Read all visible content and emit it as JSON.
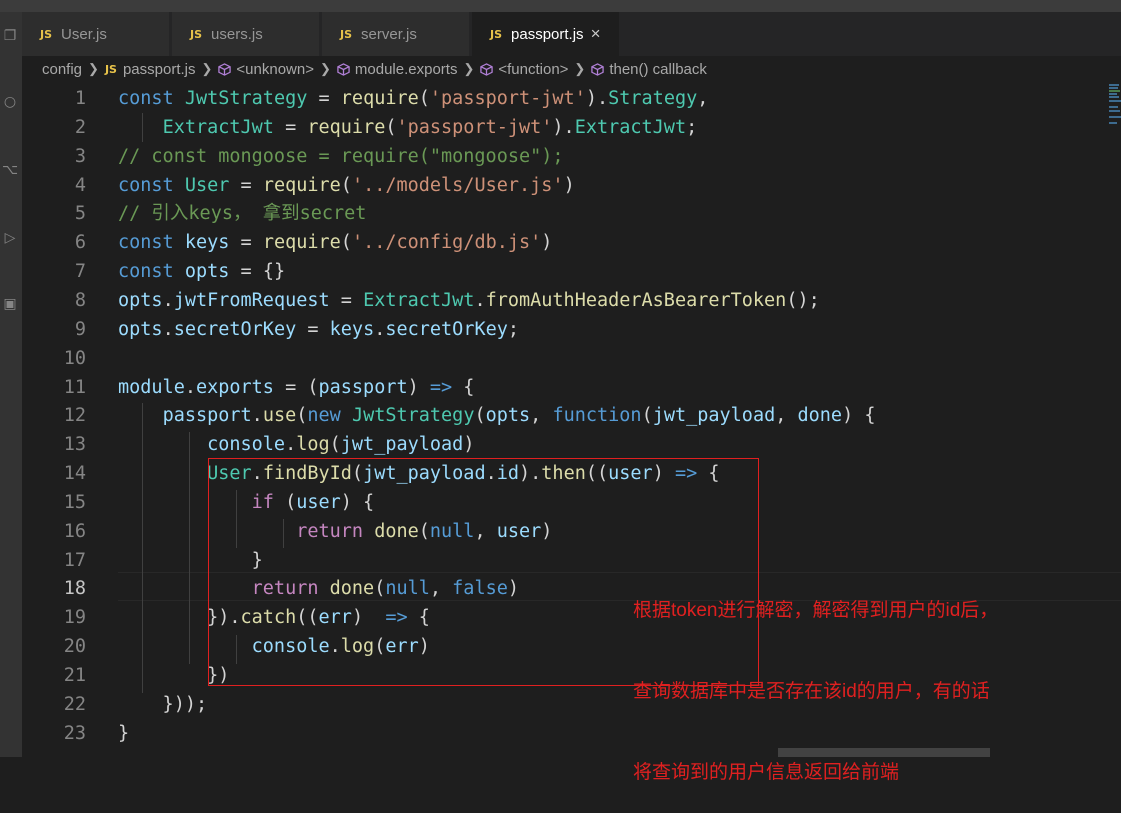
{
  "tabs": [
    {
      "badge": "JS",
      "name": "User.js"
    },
    {
      "badge": "JS",
      "name": "users.js"
    },
    {
      "badge": "JS",
      "name": "server.js"
    },
    {
      "badge": "JS",
      "name": "passport.js",
      "active": true,
      "close": "×"
    }
  ],
  "breadcrumb": {
    "folder": "config",
    "file_badge": "JS",
    "file": "passport.js",
    "items": [
      "<unknown>",
      "module.exports",
      "<function>",
      "then() callback"
    ]
  },
  "editor": {
    "current_line": 18,
    "line_numbers": [
      "1",
      "2",
      "3",
      "4",
      "5",
      "6",
      "7",
      "8",
      "9",
      "10",
      "11",
      "12",
      "13",
      "14",
      "15",
      "16",
      "17",
      "18",
      "19",
      "20",
      "21",
      "22",
      "23"
    ],
    "lines": [
      "const JwtStrategy = require('passport-jwt').Strategy,",
      "    ExtractJwt = require('passport-jwt').ExtractJwt;",
      "// const mongoose = require(\"mongoose\");",
      "const User = require('../models/User.js')",
      "// 引入keys， 拿到secret",
      "const keys = require('../config/db.js')",
      "const opts = {}",
      "opts.jwtFromRequest = ExtractJwt.fromAuthHeaderAsBearerToken();",
      "opts.secretOrKey = keys.secretOrKey;",
      "",
      "module.exports = (passport) => {",
      "    passport.use(new JwtStrategy(opts, function(jwt_payload, done) {",
      "        console.log(jwt_payload)",
      "        User.findById(jwt_payload.id).then((user) => {",
      "            if (user) {",
      "                return done(null, user)",
      "            }",
      "            return done(null, false)",
      "        }).catch((err)  => {",
      "            console.log(err)",
      "        })",
      "    }));",
      "}"
    ]
  },
  "annotation": [
    "根据token进行解密，解密得到用户的id后，",
    "查询数据库中是否存在该id的用户，有的话",
    "将查询到的用户信息返回给前端"
  ],
  "colors": {
    "annotation": "#e02020",
    "keyword": "#569cd6",
    "string": "#ce9178",
    "comment": "#6a9955"
  }
}
